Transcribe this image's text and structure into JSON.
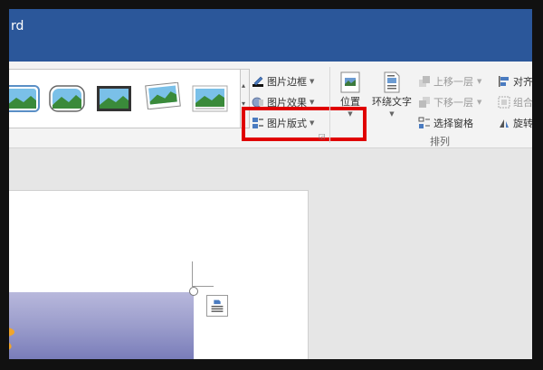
{
  "titlebar": {
    "title": "rd"
  },
  "picture_styles": {
    "thumbnail_count": 5
  },
  "picture_format": {
    "border_label": "图片边框",
    "effects_label": "图片效果",
    "layout_label": "图片版式"
  },
  "arrange": {
    "position_label": "位置",
    "wrap_text_label": "环绕文字",
    "bring_forward_label": "上移一层",
    "send_backward_label": "下移一层",
    "selection_pane_label": "选择窗格",
    "align_label": "对齐",
    "group_label": "组合",
    "rotate_label": "旋转",
    "group_title": "排列"
  },
  "colors": {
    "title_bar": "#2b579a",
    "highlight": "#e00000",
    "ribbon": "#f3f3f3",
    "canvas": "#e6e6e6"
  }
}
